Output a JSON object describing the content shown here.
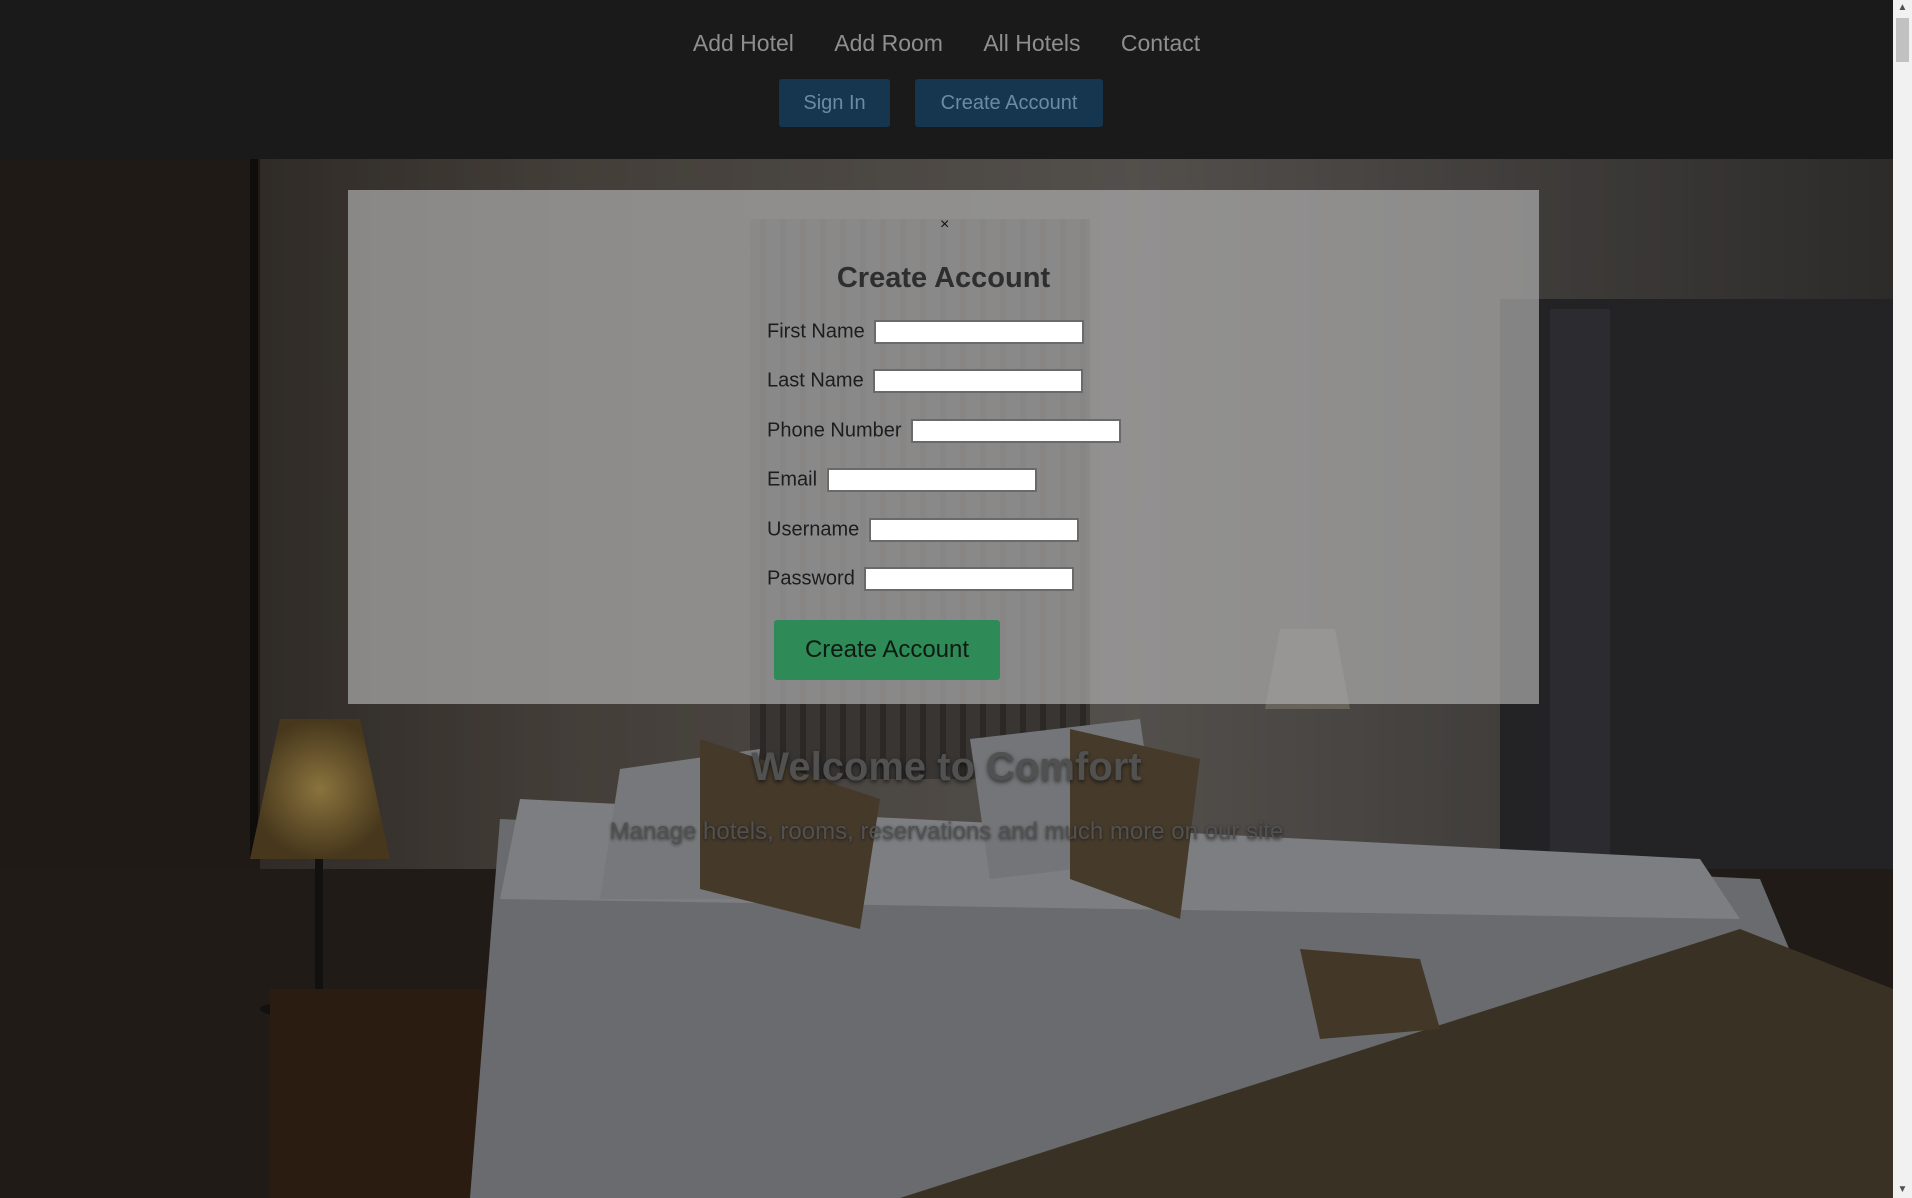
{
  "nav": {
    "links": [
      "Add Hotel",
      "Add Room",
      "All Hotels",
      "Contact"
    ],
    "sign_in": "Sign In",
    "create_account": "Create Account"
  },
  "hero": {
    "title": "Welcome to Comfort",
    "subtitle": "Manage hotels, rooms, reservations and much more on our site"
  },
  "modal": {
    "close": "×",
    "title": "Create Account",
    "fields": [
      {
        "label": "First Name",
        "value": ""
      },
      {
        "label": "Last Name",
        "value": ""
      },
      {
        "label": "Phone Number",
        "value": ""
      },
      {
        "label": "Email",
        "value": ""
      },
      {
        "label": "Username",
        "value": ""
      },
      {
        "label": "Password",
        "value": ""
      }
    ],
    "submit": "Create Account"
  },
  "scrollbar": {
    "up_icon": "scroll-up-arrow",
    "down_icon": "scroll-down-arrow"
  },
  "colors": {
    "header_bg": "#1a1a1a",
    "auth_button": "#163650",
    "submit_button": "#2e8a56"
  }
}
